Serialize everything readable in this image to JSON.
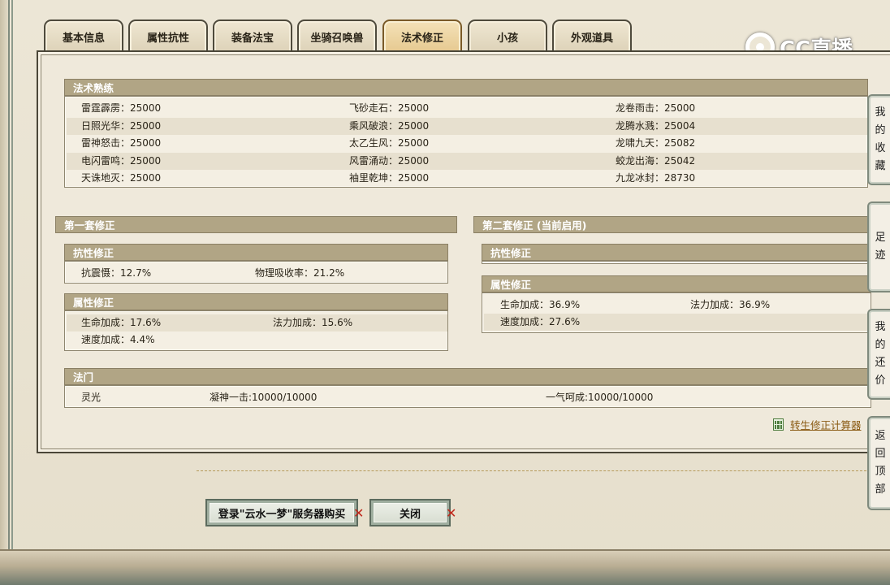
{
  "tabs": [
    "基本信息",
    "属性抗性",
    "装备法宝",
    "坐骑召唤兽",
    "法术修正",
    "小孩",
    "外观道具"
  ],
  "active_tab": "法术修正",
  "logo_text": "CC直播",
  "spell_mastery": {
    "title": "法术熟练",
    "rows": [
      [
        "雷霆霹雳：25000",
        "飞砂走石：25000",
        "龙卷雨击：25000"
      ],
      [
        "日照光华：25000",
        "乘风破浪：25000",
        "龙腾水溅：25004"
      ],
      [
        "雷神怒击：25000",
        "太乙生风：25000",
        "龙啸九天：25082"
      ],
      [
        "电闪雷鸣：25000",
        "风雷涌动：25000",
        "蛟龙出海：25042"
      ],
      [
        "天诛地灭：25000",
        "袖里乾坤：25000",
        "九龙冰封：28730"
      ]
    ]
  },
  "set1": {
    "title": "第一套修正",
    "resist_title": "抗性修正",
    "resist_items": [
      "抗震慑：12.7%",
      "物理吸收率：21.2%"
    ],
    "attr_title": "属性修正",
    "attr_rows": [
      [
        "生命加成：17.6%",
        "法力加成：15.6%"
      ],
      [
        "速度加成：4.4%"
      ]
    ]
  },
  "set2": {
    "title": "第二套修正 (当前启用)",
    "resist_title": "抗性修正",
    "attr_title": "属性修正",
    "attr_rows": [
      [
        "生命加成：36.9%",
        "法力加成：36.9%"
      ],
      [
        "速度加成：27.6%"
      ]
    ]
  },
  "famen": {
    "title": "法门",
    "items": [
      "灵光",
      "凝神一击:10000/10000",
      "一气呵成:10000/10000"
    ]
  },
  "calc_link": "转生修正计算器",
  "buttons": {
    "buy": "登录\"云水一梦\"服务器购买",
    "close": "关闭"
  },
  "side_tabs": {
    "favorites": [
      "我",
      "的",
      "收",
      "藏"
    ],
    "footprints": [
      "足",
      "迹"
    ],
    "my_bids": [
      "我",
      "的",
      "还",
      "价"
    ],
    "back_top": [
      "返",
      "回",
      "顶",
      "部"
    ]
  }
}
